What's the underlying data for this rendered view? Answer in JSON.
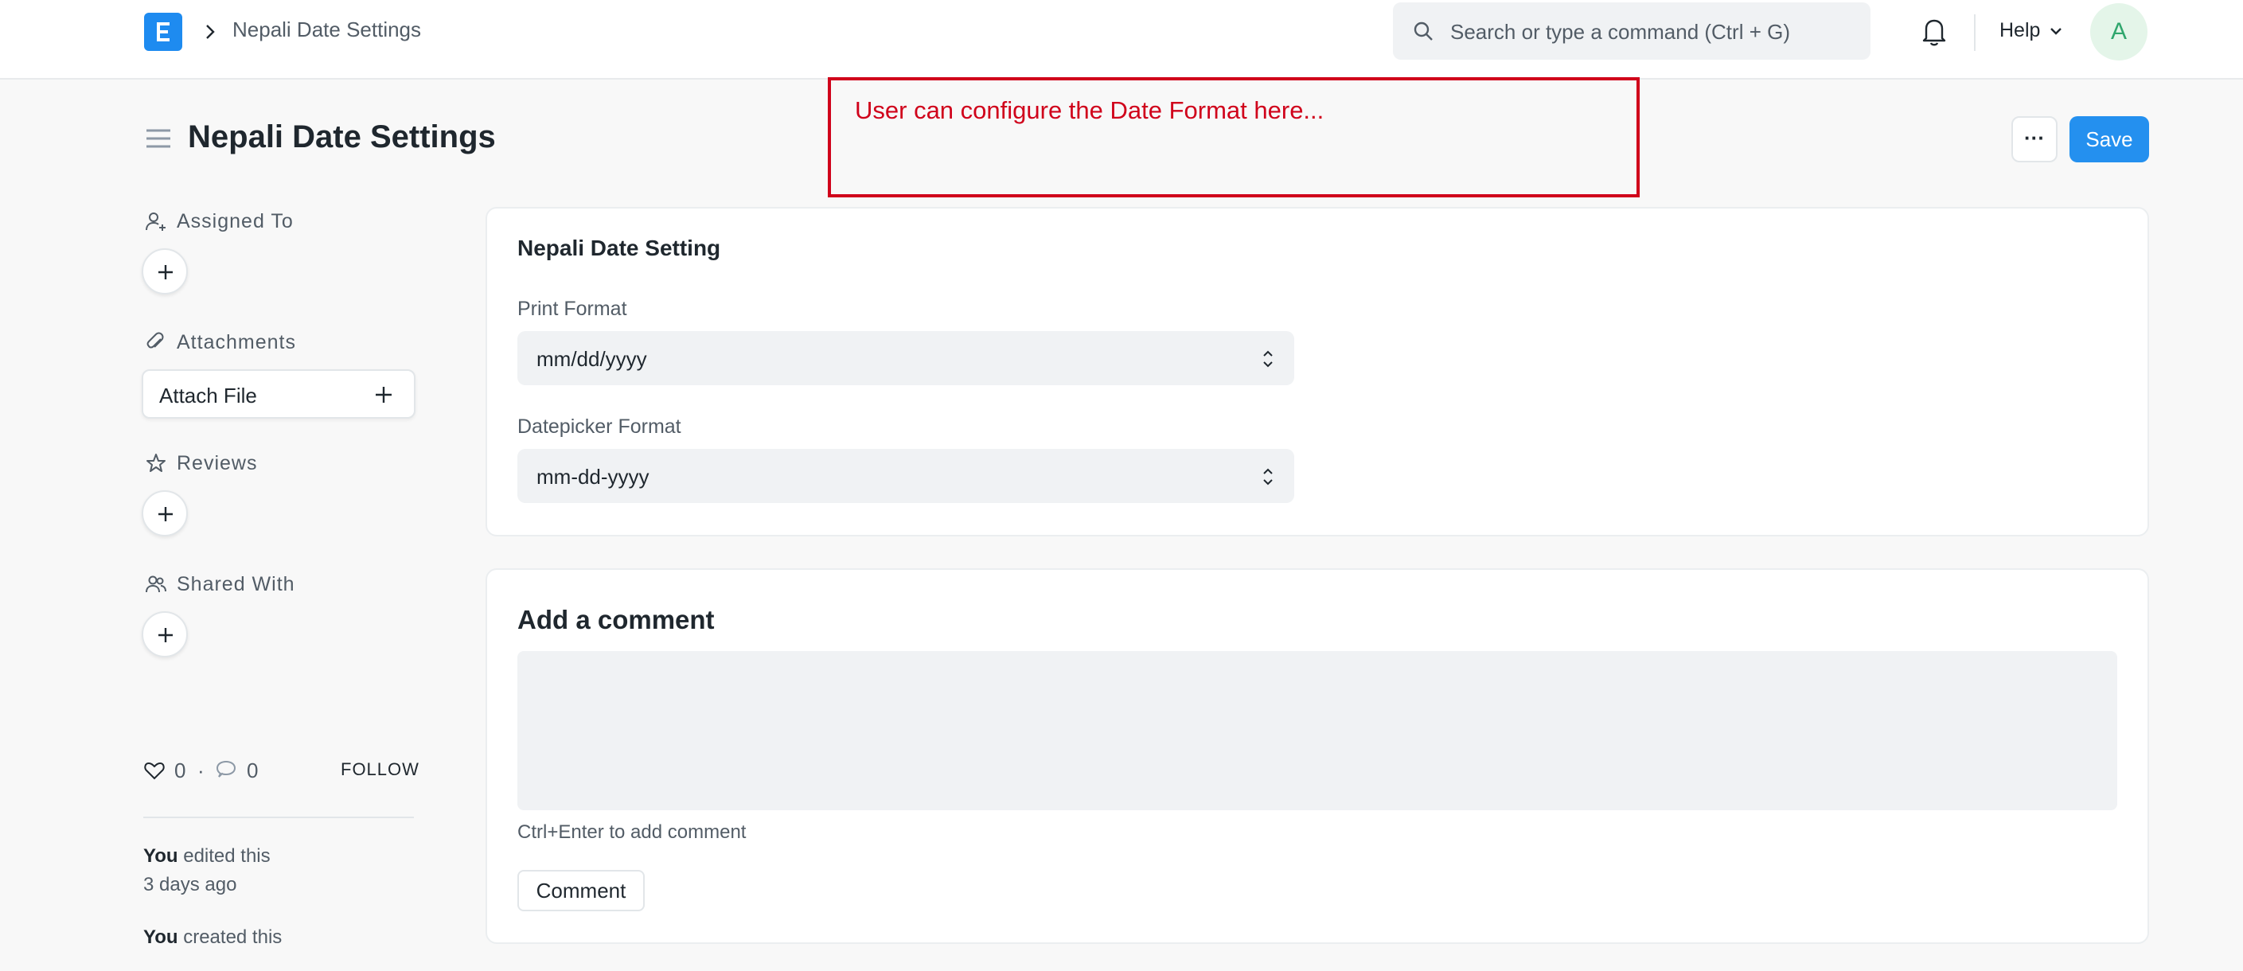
{
  "navbar": {
    "logo_letter": "E",
    "breadcrumb": "Nepali Date Settings",
    "search_placeholder": "Search or type a command (Ctrl + G)",
    "help_label": "Help",
    "avatar_initial": "A"
  },
  "page": {
    "title": "Nepali Date Settings",
    "more_label": "···",
    "save_label": "Save"
  },
  "annotation": {
    "text": "User can configure the Date Format here...",
    "color": "#d0021b"
  },
  "sidebar": {
    "assigned_to": "Assigned To",
    "attachments": "Attachments",
    "attach_file": "Attach File",
    "reviews": "Reviews",
    "shared_with": "Shared With",
    "likes": "0",
    "comments": "0",
    "dot": "·",
    "follow": "FOLLOW",
    "activity": [
      {
        "who": "You",
        "what": " edited this",
        "when": "3 days ago"
      },
      {
        "who": "You",
        "what": " created this"
      }
    ]
  },
  "form": {
    "section_title": "Nepali Date Setting",
    "print_format_label": "Print Format",
    "print_format_value": "mm/dd/yyyy",
    "datepicker_format_label": "Datepicker Format",
    "datepicker_format_value": "mm-dd-yyyy"
  },
  "comment": {
    "title": "Add a comment",
    "hint": "Ctrl+Enter to add comment",
    "button": "Comment"
  },
  "colors": {
    "primary": "#2490ef",
    "logo": "#1e8bf0",
    "annotation": "#d0021b",
    "avatar_bg": "#e4f5e9",
    "avatar_fg": "#30a66d"
  }
}
